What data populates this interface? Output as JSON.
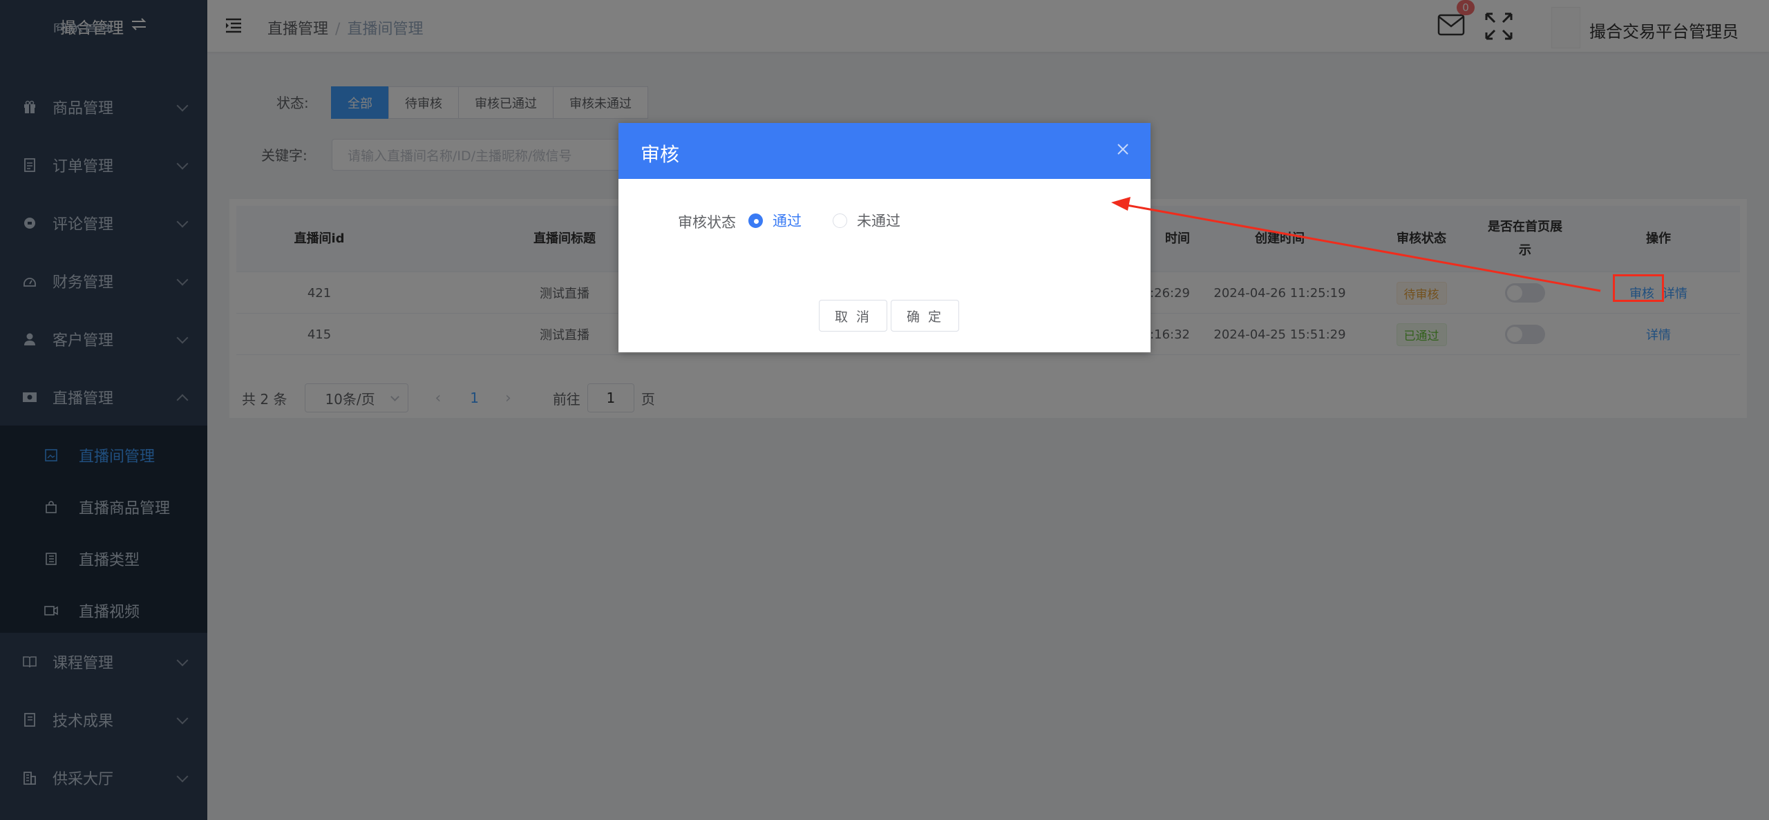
{
  "sidebar": {
    "logo_text": "撮合管理",
    "top_partial_label": "商家管理",
    "items": [
      {
        "label": "商品管理",
        "icon": "gift-icon"
      },
      {
        "label": "订单管理",
        "icon": "document-icon"
      },
      {
        "label": "评论管理",
        "icon": "comment-icon"
      },
      {
        "label": "财务管理",
        "icon": "finance-icon"
      },
      {
        "label": "客户管理",
        "icon": "user-icon"
      },
      {
        "label": "直播管理",
        "icon": "live-icon"
      },
      {
        "label": "课程管理",
        "icon": "book-icon"
      },
      {
        "label": "技术成果",
        "icon": "notebook-icon"
      },
      {
        "label": "供采大厅",
        "icon": "building-icon"
      }
    ],
    "sub_items": [
      {
        "label": "直播间管理",
        "icon": "image-icon"
      },
      {
        "label": "直播商品管理",
        "icon": "bag-icon"
      },
      {
        "label": "直播类型",
        "icon": "list-icon"
      },
      {
        "label": "直播视频",
        "icon": "video-icon"
      }
    ]
  },
  "header": {
    "breadcrumb": [
      "直播管理",
      "直播间管理"
    ],
    "breadcrumb_sep": "/",
    "mail_badge": "0",
    "username": "撮合交易平台管理员"
  },
  "filter": {
    "status_label": "状态:",
    "status_tabs": [
      "全部",
      "待审核",
      "审核已通过",
      "审核未通过"
    ],
    "keyword_label": "关键字:",
    "keyword_placeholder": "请输入直播间名称/ID/主播昵称/微信号"
  },
  "table": {
    "headers": {
      "id": "直播间id",
      "title": "直播间标题",
      "start_time": "时间",
      "created": "创建时间",
      "audit": "审核状态",
      "homepage": "是否在首页展示",
      "actions": "操作"
    },
    "rows": [
      {
        "id": "421",
        "title": "测试直播",
        "start_time": ":26:29",
        "created": "2024-04-26 11:25:19",
        "audit": "待审核",
        "action_audit": "审核",
        "action_detail": "详情"
      },
      {
        "id": "415",
        "title": "测试直播",
        "start_time": ":16:32",
        "created": "2024-04-25 15:51:29",
        "audit": "已通过",
        "action_detail": "详情"
      }
    ]
  },
  "pagination": {
    "total": "共 2 条",
    "page_size": "10条/页",
    "prev": "‹",
    "current": "1",
    "next": "›",
    "goto_label": "前往",
    "goto_value": "1",
    "goto_suffix": "页"
  },
  "dialog": {
    "title": "审核",
    "field_label": "审核状态",
    "option_pass": "通过",
    "option_fail": "未通过",
    "cancel": "取 消",
    "confirm": "确 定"
  },
  "colors": {
    "accent": "#409eff",
    "dialog_header": "#3a7bf4",
    "annotation": "#f02c1c",
    "sidebar_bg": "#304156"
  }
}
